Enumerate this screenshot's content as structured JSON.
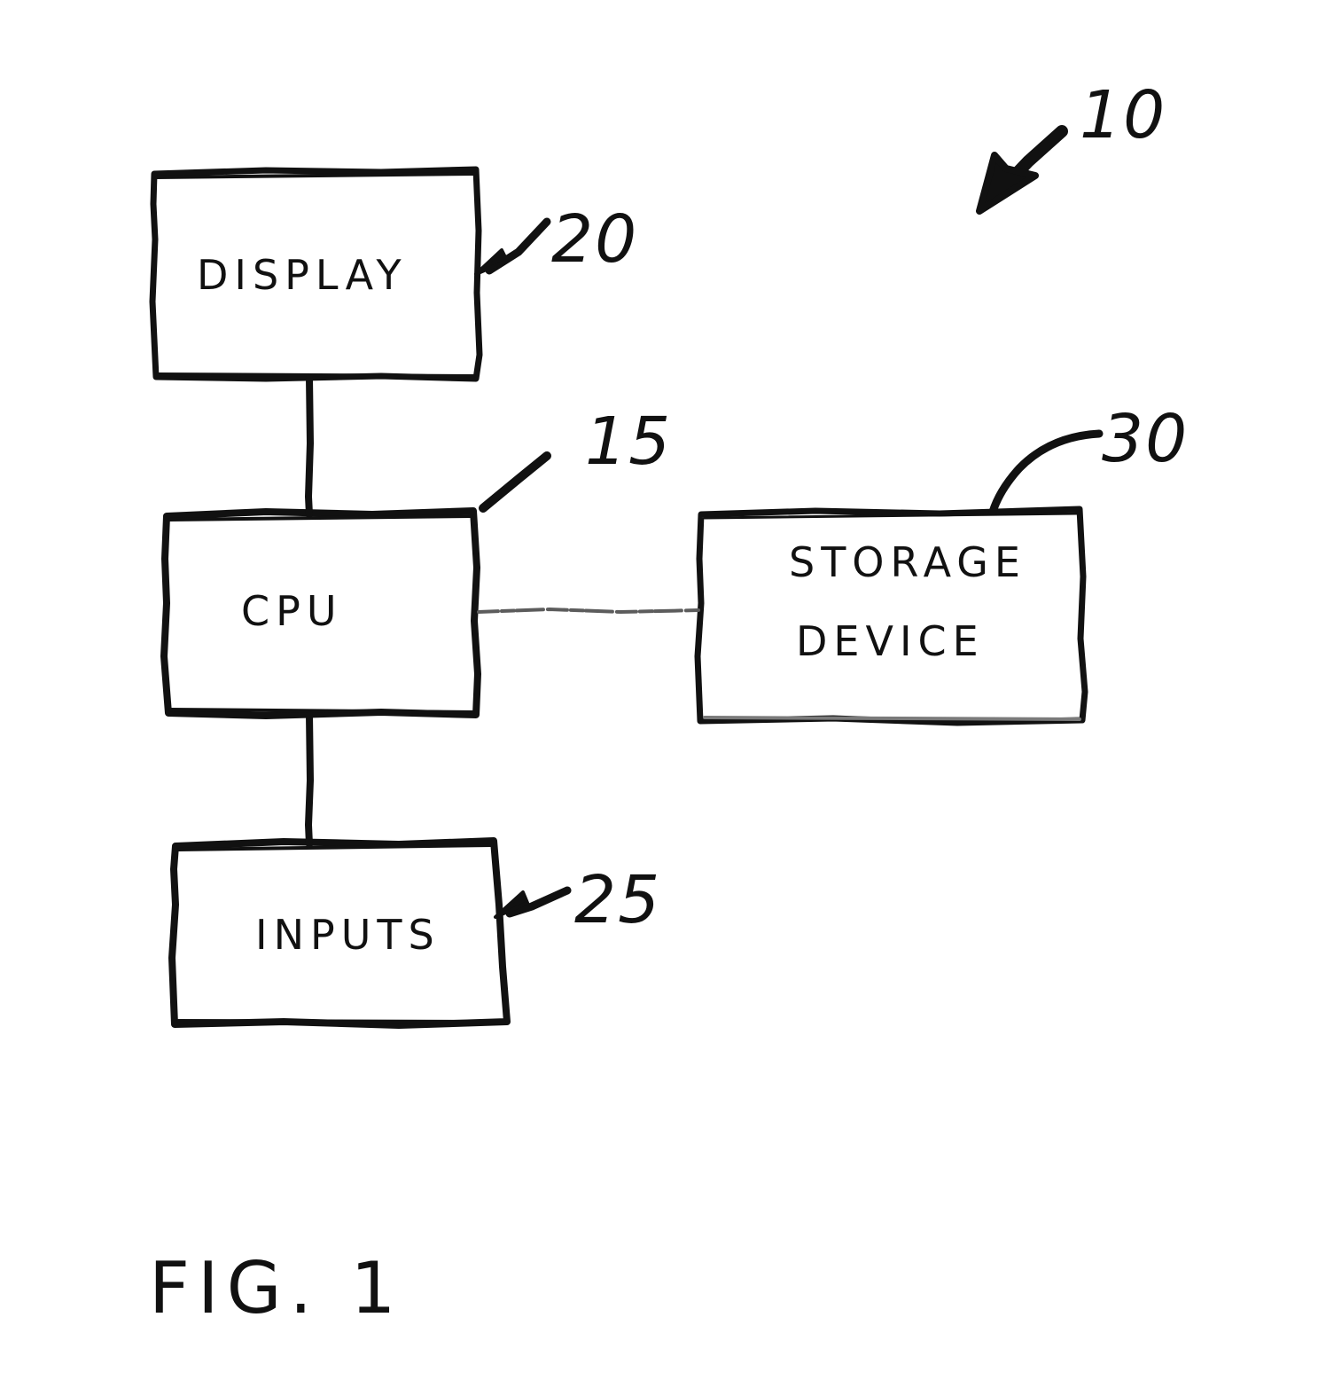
{
  "figure": {
    "caption": "FIG. 1",
    "system_reference": "10",
    "bus_reference": "15"
  },
  "blocks": [
    {
      "id": "display",
      "label": "DISPLAY",
      "reference": "20"
    },
    {
      "id": "cpu",
      "label": "CPU",
      "reference": "15"
    },
    {
      "id": "inputs",
      "label": "INPUTS",
      "reference": "25"
    },
    {
      "id": "storage-device",
      "label_line1": "STORAGE",
      "label_line2": "DEVICE",
      "reference": "30"
    }
  ],
  "colors": {
    "ink": "#111111",
    "faint_ink": "#6d6d6d",
    "paper": "#ffffff"
  }
}
